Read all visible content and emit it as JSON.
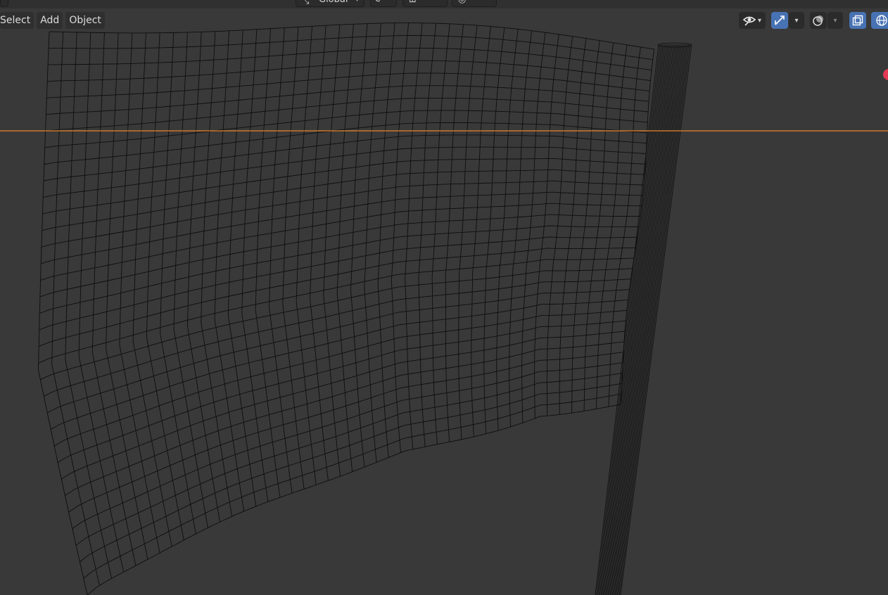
{
  "header": {
    "orientation_label": "Global",
    "orientation_icon": "transform-orientation-icon",
    "pivot_icon": "pivot-point-icon",
    "snap_icon": "snap-icon",
    "proportional_icon": "proportional-editing-icon"
  },
  "menu": {
    "select_label": "Select",
    "add_label": "Add",
    "object_label": "Object"
  },
  "viewport_controls": {
    "visibility_icon": "eye-visibility-icon",
    "gizmo_icon": "gizmo-toggle-icon",
    "overlay_icon": "overlays-icon",
    "xray_icon": "xray-toggle-icon",
    "shading_icon": "wireframe-shading-icon"
  },
  "colors": {
    "background": "#393939",
    "wire": "#0e0e0e",
    "selection_line": "#e8832e",
    "active_button": "#4772b3",
    "gizmo_x": "#e23a55"
  }
}
